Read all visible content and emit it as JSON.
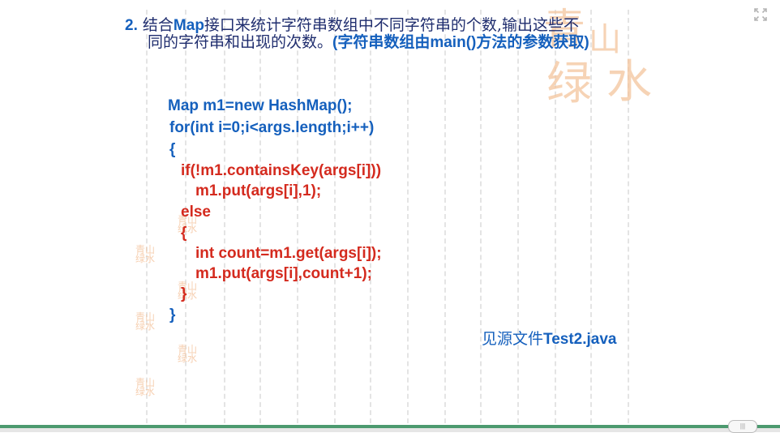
{
  "heading": {
    "number": "2.",
    "part1": "结合",
    "kw_map": "Map",
    "part2": "接口来统计字符串数组中不同字符串的个数,输出这些不",
    "part3": "同的字符串和出现的次数。",
    "part4": "(字符串数组由",
    "kw_main": "main()",
    "part5": "方法的参数获取)"
  },
  "code_lines": [
    "Map m1=new HashMap();",
    "for(int i=0;i<args.length;i++)",
    "{",
    "if(!m1.containsKey(args[i]))",
    "m1.put(args[i],1);",
    "else",
    "{",
    "int count=m1.get(args[i]);",
    "m1.put(args[i],count+1);",
    "}",
    "}"
  ],
  "note": {
    "prefix": "见源文件",
    "filename": "Test2.java"
  },
  "watermark": {
    "seal_text": "青山绿水"
  },
  "icons": {
    "fullscreen": "fullscreen-icon",
    "scroll": "scroll-grip-icon"
  },
  "colors": {
    "heading_accent": "#1560bd",
    "code_blue": "#1560bd",
    "code_red": "#d42a1e",
    "bottom_bar": "#4c9a6f",
    "seal": "#f5c7a3"
  }
}
